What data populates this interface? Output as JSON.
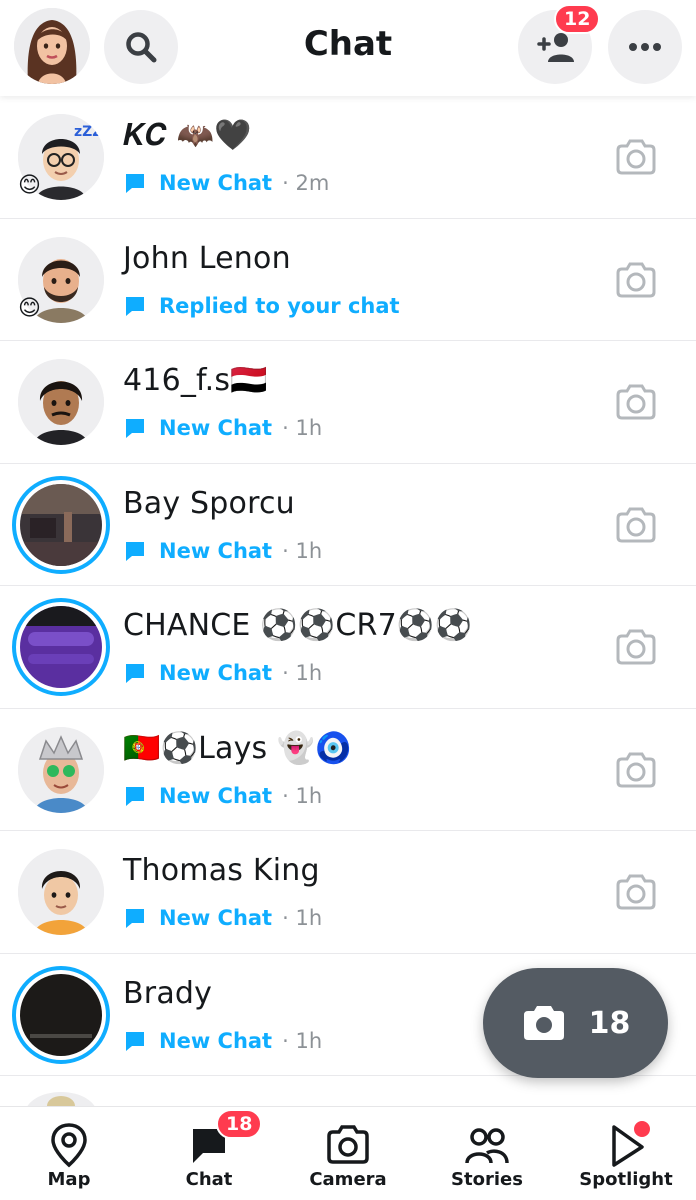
{
  "header": {
    "title": "Chat",
    "add_friend_badge": "12"
  },
  "chats": [
    {
      "name": "𝑲𝑪 🦇🖤",
      "status": "New Chat",
      "time": "· 2m",
      "mini_emoji": "😊"
    },
    {
      "name": "John Lenon",
      "status": "Replied to your chat",
      "time": "",
      "mini_emoji": "😊"
    },
    {
      "name": "416_f.s🇾🇪",
      "status": "New Chat",
      "time": "· 1h",
      "mini_emoji": ""
    },
    {
      "name": "Bay Sporcu",
      "status": "New Chat",
      "time": "· 1h",
      "mini_emoji": ""
    },
    {
      "name": "CHANCE ⚽⚽CR7⚽⚽",
      "status": "New Chat",
      "time": "· 1h",
      "mini_emoji": ""
    },
    {
      "name": "🇵🇹⚽Lays 👻🧿",
      "status": "New Chat",
      "time": "· 1h",
      "mini_emoji": ""
    },
    {
      "name": "Thomas King",
      "status": "New Chat",
      "time": "· 1h",
      "mini_emoji": ""
    },
    {
      "name": "Brady",
      "status": "New Chat",
      "time": "· 1h",
      "mini_emoji": ""
    }
  ],
  "camera_fab": {
    "count": "18"
  },
  "bottom_nav": {
    "map": "Map",
    "chat": "Chat",
    "chat_badge": "18",
    "camera": "Camera",
    "stories": "Stories",
    "spotlight": "Spotlight"
  },
  "colors": {
    "accent_blue": "#0fadff",
    "badge_red": "#ff3b4f",
    "fab_gray": "#545b63"
  }
}
